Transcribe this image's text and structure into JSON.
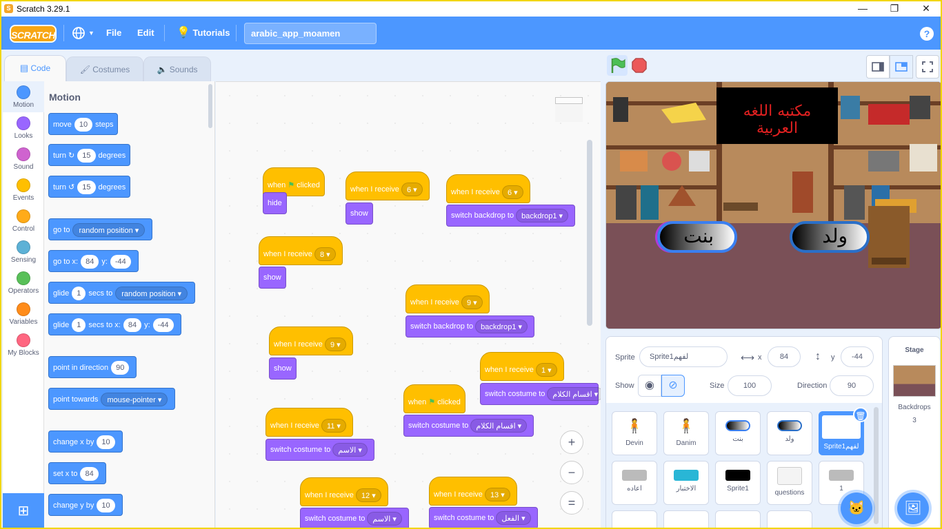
{
  "window": {
    "title": "Scratch 3.29.1",
    "minimize": "—",
    "restore": "❐",
    "close": "✕"
  },
  "menubar": {
    "logo": "SCRATCH",
    "language_icon": "globe-icon",
    "file": "File",
    "edit": "Edit",
    "tutorials": "Tutorials",
    "project_name": "arabic_app_moamen",
    "help": "?"
  },
  "tabs": [
    {
      "label": "Code"
    },
    {
      "label": "Costumes"
    },
    {
      "label": "Sounds"
    }
  ],
  "categories": [
    {
      "label": "Motion",
      "color": "#4c97ff"
    },
    {
      "label": "Looks",
      "color": "#9966ff"
    },
    {
      "label": "Sound",
      "color": "#cf63cf"
    },
    {
      "label": "Events",
      "color": "#ffbf00"
    },
    {
      "label": "Control",
      "color": "#ffab19"
    },
    {
      "label": "Sensing",
      "color": "#5cb1d6"
    },
    {
      "label": "Operators",
      "color": "#59c059"
    },
    {
      "label": "Variables",
      "color": "#ff8c1a"
    },
    {
      "label": "My Blocks",
      "color": "#ff6680"
    }
  ],
  "palette": {
    "title": "Motion",
    "move": {
      "a": "move",
      "v": "10",
      "b": "steps"
    },
    "turn_right": {
      "a": "turn",
      "v": "15",
      "b": "degrees"
    },
    "turn_left": {
      "a": "turn",
      "v": "15",
      "b": "degrees"
    },
    "goto": {
      "a": "go to",
      "dd": "random position"
    },
    "goto_xy": {
      "a": "go to x:",
      "x": "84",
      "b": "y:",
      "y": "-44"
    },
    "glide": {
      "a": "glide",
      "v": "1",
      "b": "secs to",
      "dd": "random position"
    },
    "glide_xy": {
      "a": "glide",
      "v": "1",
      "b": "secs to x:",
      "x": "84",
      "c": "y:",
      "y": "-44"
    },
    "point_dir": {
      "a": "point in direction",
      "v": "90"
    },
    "point_towards": {
      "a": "point towards",
      "dd": "mouse-pointer"
    },
    "change_x": {
      "a": "change x by",
      "v": "10"
    },
    "set_x": {
      "a": "set x to",
      "v": "84"
    },
    "change_y": {
      "a": "change y by",
      "v": "10"
    }
  },
  "scripts": {
    "s1": {
      "hat": "when",
      "hat2": "clicked",
      "body": "hide"
    },
    "s2": {
      "hat": "when I receive",
      "msg": "6",
      "body": "show"
    },
    "s3": {
      "hat": "when I receive",
      "msg": "6",
      "body": "switch backdrop to",
      "val": "backdrop1"
    },
    "s4": {
      "hat": "when I receive",
      "msg": "8",
      "body": "show"
    },
    "s5": {
      "hat": "when I receive",
      "msg": "9",
      "body": "switch backdrop to",
      "val": "backdrop1"
    },
    "s6": {
      "hat": "when I receive",
      "msg": "9",
      "body": "show"
    },
    "s7": {
      "hat": "when I receive",
      "msg": "1",
      "body": "switch costume to",
      "val": "اقسام الكلام"
    },
    "s8": {
      "hat": "when",
      "hat2": "clicked",
      "body": "switch costume to",
      "val": "اقسام الكلام"
    },
    "s9": {
      "hat": "when I receive",
      "msg": "11",
      "body": "switch costume to",
      "val": "الاسم"
    },
    "s10": {
      "hat": "when I receive",
      "msg": "12",
      "body": "switch costume to",
      "val": "الاسم"
    },
    "s11": {
      "hat": "when I receive",
      "msg": "13",
      "body": "switch costume to",
      "val": "الفعل"
    }
  },
  "zoom": {
    "in": "+",
    "out": "−",
    "reset": "="
  },
  "stage": {
    "banner": "مكتبه اللغه العربية",
    "btn_girl": "بنت",
    "btn_boy": "ولد"
  },
  "sprite_info": {
    "sprite_label": "Sprite",
    "sprite_name": "Sprite1لفهم",
    "x_label": "x",
    "x": "84",
    "y_label": "y",
    "y": "-44",
    "show_label": "Show",
    "size_label": "Size",
    "size": "100",
    "direction_label": "Direction",
    "direction": "90"
  },
  "sprites": [
    {
      "name": "Devin"
    },
    {
      "name": "Danim"
    },
    {
      "name": "بنت"
    },
    {
      "name": "ولد"
    },
    {
      "name": "Sprite1لفهم"
    },
    {
      "name": "اعاده"
    },
    {
      "name": "الاختبار"
    },
    {
      "name": "Sprite1"
    },
    {
      "name": "questions"
    },
    {
      "name": "1"
    }
  ],
  "stage_pane": {
    "title": "Stage",
    "backdrops_label": "Backdrops",
    "backdrops_count": "3"
  }
}
